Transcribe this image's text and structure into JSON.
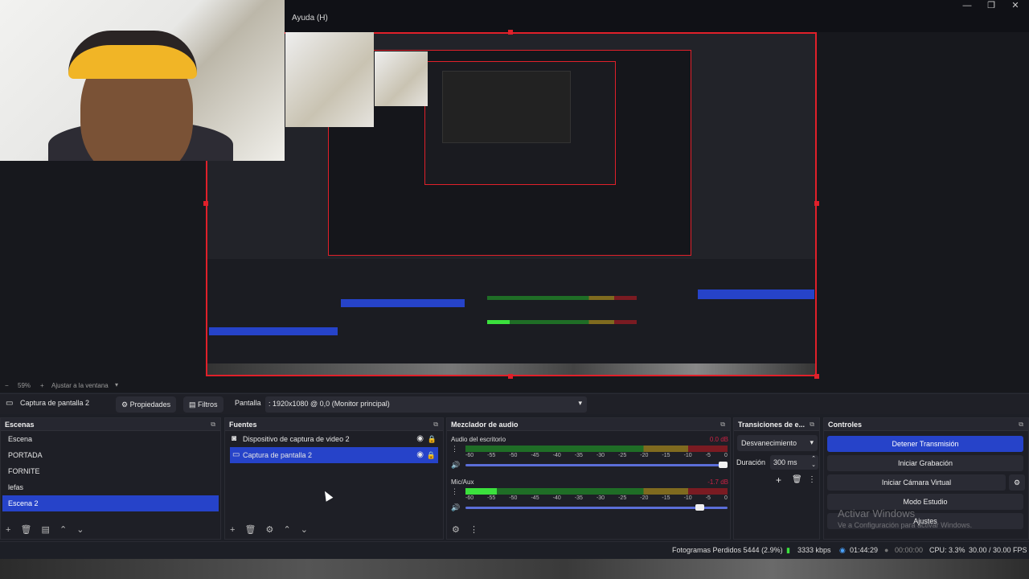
{
  "window": {
    "menu_help": "Ayuda (H)",
    "controls": [
      "—",
      "❐",
      "✕"
    ]
  },
  "preview": {
    "zoom": "59%",
    "fit_label": "Ajustar a la ventana"
  },
  "source_toolbar": {
    "selected_source": "Captura de pantalla 2",
    "properties_label": "Propiedades",
    "filters_label": "Filtros",
    "screen_label": "Pantalla",
    "screen_value": ": 1920x1080 @ 0,0 (Monitor principal)"
  },
  "scenes": {
    "title": "Escenas",
    "items": [
      "Escena",
      "PORTADA",
      "FORNITE",
      "lefas",
      "Escena 2"
    ],
    "selected_index": 4
  },
  "sources": {
    "title": "Fuentes",
    "items": [
      {
        "icon": "camera-icon",
        "label": "Dispositivo de captura de video 2"
      },
      {
        "icon": "monitor-icon",
        "label": "Captura de pantalla 2"
      }
    ],
    "selected_index": 1
  },
  "mixer": {
    "title": "Mezclador de audio",
    "channels": [
      {
        "name": "Audio del escritorio",
        "db": "0.0 dB",
        "level": 0.0,
        "volume": 1.0
      },
      {
        "name": "Mic/Aux",
        "db": "-1.7 dB",
        "level": 0.12,
        "volume": 0.9
      }
    ],
    "ticks": [
      "-60",
      "-55",
      "-50",
      "-45",
      "-40",
      "-35",
      "-30",
      "-25",
      "-20",
      "-15",
      "-10",
      "-5",
      "0"
    ]
  },
  "transitions": {
    "title": "Transiciones de e...",
    "transition": "Desvanecimiento",
    "duration_label": "Duración",
    "duration_value": "300 ms"
  },
  "controls": {
    "title": "Controles",
    "stop_stream": "Detener Transmisión",
    "start_recording": "Iniciar Grabación",
    "start_virtual_cam": "Iniciar Cámara Virtual",
    "studio_mode": "Modo Estudio",
    "settings": "Ajustes"
  },
  "activation": {
    "title": "Activar Windows",
    "subtitle": "Ve a Configuración para activar Windows."
  },
  "status": {
    "dropped_frames": "Fotogramas Perdidos 5444 (2.9%)",
    "bitrate": "3333 kbps",
    "stream_time": "01:44:29",
    "rec_time": "00:00:00",
    "cpu": "CPU: 3.3%",
    "fps": "30.00 / 30.00 FPS"
  },
  "colors": {
    "accent": "#2643c9",
    "selection_border": "#e0202a",
    "meter_green": "#3be03d"
  }
}
